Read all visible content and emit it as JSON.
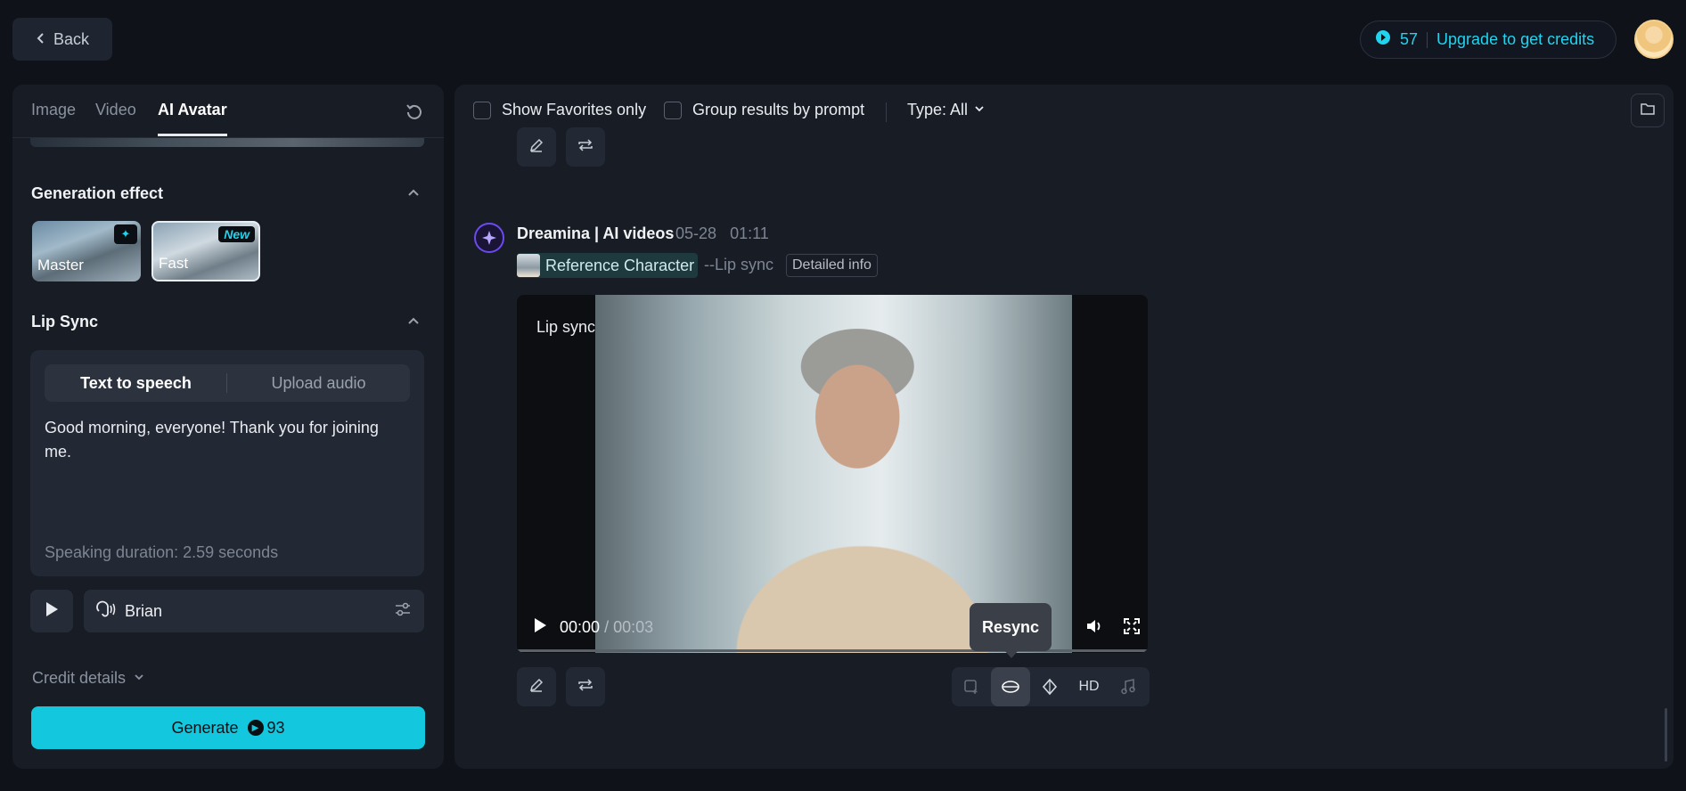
{
  "topbar": {
    "back_label": "Back",
    "credits_count": "57",
    "upgrade_label": "Upgrade to get credits"
  },
  "left": {
    "tabs": [
      {
        "label": "Image"
      },
      {
        "label": "Video"
      },
      {
        "label": "AI Avatar"
      }
    ],
    "generation_effect": {
      "title": "Generation effect",
      "options": [
        {
          "label": "Master"
        },
        {
          "label": "Fast",
          "badge": "New"
        }
      ]
    },
    "lip_sync": {
      "title": "Lip Sync",
      "modes": [
        "Text to speech",
        "Upload audio"
      ],
      "text": "Good morning, everyone! Thank you for joining me.",
      "duration": "Speaking duration: 2.59 seconds"
    },
    "voice_name": "Brian",
    "credit_details_label": "Credit details",
    "generate_label": "Generate",
    "generate_cost": "93"
  },
  "right": {
    "filters": {
      "favorites_label": "Show Favorites only",
      "group_label": "Group results by prompt",
      "type_label": "Type: All"
    },
    "entry": {
      "title": "Dreamina | AI videos",
      "date": "05-28",
      "time": "01:11",
      "reference_label": "Reference Character",
      "mode_tag": "--Lip sync",
      "detail_label": "Detailed info"
    },
    "video": {
      "overlay_label": "Lip sync",
      "current_time": "00:00",
      "duration": "/ 00:03"
    },
    "tooltip": "Resync",
    "toolbar_hd": "HD"
  }
}
